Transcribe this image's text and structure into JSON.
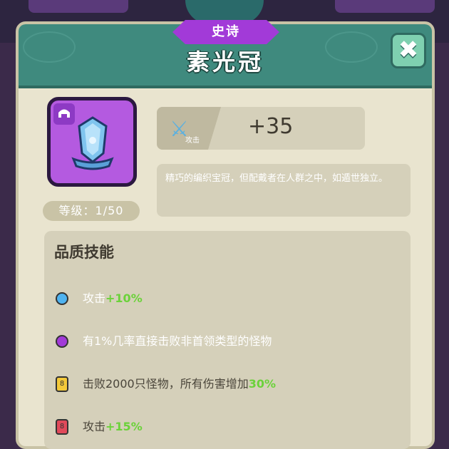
{
  "item": {
    "rarity": "史诗",
    "name": "素光冠",
    "close_label": "✖",
    "slot_icon": "helmet-icon",
    "level": "等级：1/50"
  },
  "stat": {
    "icon": "sword-icon",
    "label": "攻击",
    "value": "+35"
  },
  "description": "精巧的编织宝冠，但配戴者在人群之中，如遁世独立。",
  "skills": {
    "heading": "品质技能",
    "list": [
      {
        "icon": "blue-circle-icon",
        "color": "#4fb3f0",
        "text": "攻击",
        "bonus": "+10%"
      },
      {
        "icon": "purple-circle-icon",
        "color": "#a23ad8",
        "text": "有1%几率直接击败非首领类型的怪物",
        "bonus": ""
      },
      {
        "icon": "yellow-lock-icon",
        "color": "#f3c93a",
        "text": "击败2000只怪物，所有伤害增加",
        "bonus": "30%"
      },
      {
        "icon": "red-lock-icon",
        "color": "#e04a5a",
        "text": "攻击",
        "bonus": "+15%"
      }
    ]
  },
  "colors": {
    "header": "#3f8a7e",
    "rarity": "#a23ad8",
    "bonus": "#6bd23a"
  }
}
